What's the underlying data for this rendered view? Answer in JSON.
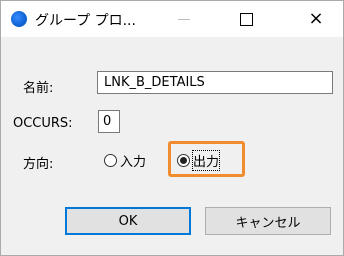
{
  "window": {
    "title": "グループ プロ...",
    "controls": {
      "minimize": "minimize-icon",
      "maximize": "maximize-icon",
      "close": "×"
    }
  },
  "form": {
    "name_label": "名前:",
    "name_value": "LNK_B_DETAILS",
    "occurs_label": "OCCURS:",
    "occurs_value": "0",
    "direction_label": "方向:",
    "direction_options": [
      {
        "label": "入力",
        "selected": false
      },
      {
        "label": "出力",
        "selected": true
      }
    ]
  },
  "buttons": {
    "ok": "OK",
    "cancel": "キャンセル"
  },
  "colors": {
    "highlight": "#f08c2e",
    "default_button_border": "#0078d7",
    "app_icon": "#1166d8"
  }
}
